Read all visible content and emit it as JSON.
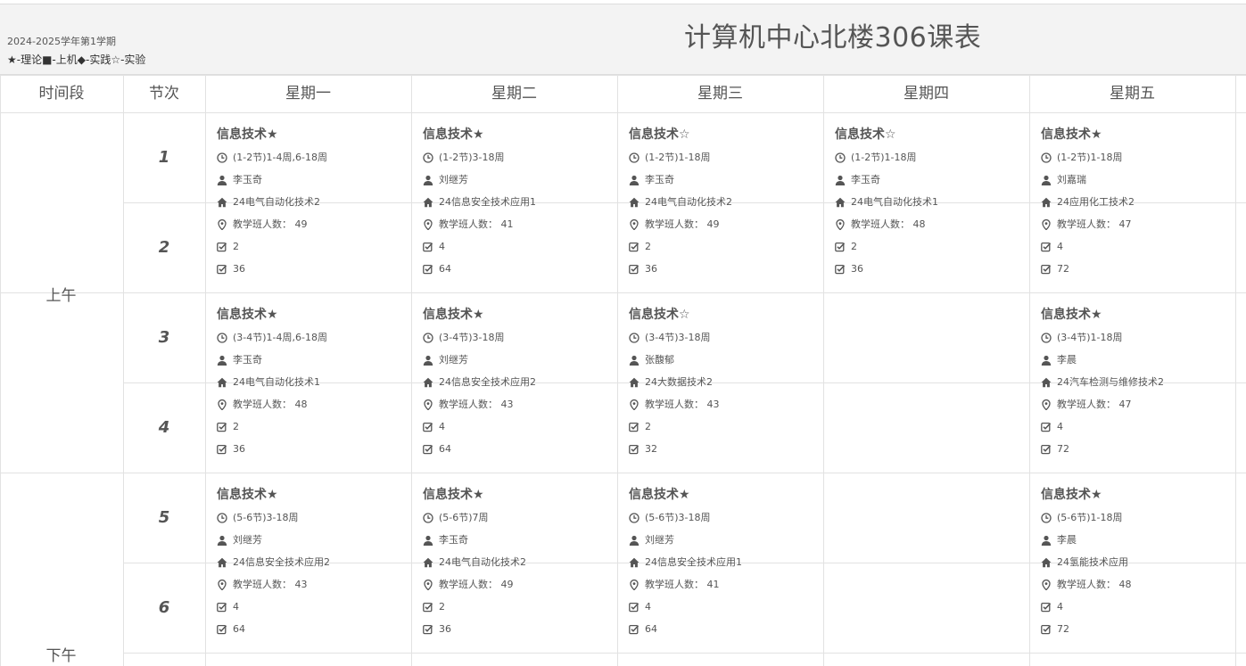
{
  "header": {
    "term": "2024-2025学年第1学期",
    "legend": "★-理论■-上机◆-实践☆-实验",
    "title": "计算机中心北楼306课表"
  },
  "columns": [
    "时间段",
    "节次",
    "星期一",
    "星期二",
    "星期三",
    "星期四",
    "星期五"
  ],
  "periods": [
    "上午",
    "下午"
  ],
  "slots": [
    "1",
    "2",
    "3",
    "4",
    "5",
    "6"
  ],
  "courses": {
    "mon_12": {
      "name": "信息技术★",
      "time": "(1-2节)1-4周,6-18周",
      "teacher": "李玉奇",
      "class": "24电气自动化技术2",
      "size": "教学班人数： 49",
      "credit": "2",
      "hours": "36"
    },
    "tue_12": {
      "name": "信息技术★",
      "time": "(1-2节)3-18周",
      "teacher": "刘继芳",
      "class": "24信息安全技术应用1",
      "size": "教学班人数： 41",
      "credit": "4",
      "hours": "64"
    },
    "wed_12": {
      "name": "信息技术☆",
      "time": "(1-2节)1-18周",
      "teacher": "李玉奇",
      "class": "24电气自动化技术2",
      "size": "教学班人数： 49",
      "credit": "2",
      "hours": "36"
    },
    "thu_12": {
      "name": "信息技术☆",
      "time": "(1-2节)1-18周",
      "teacher": "李玉奇",
      "class": "24电气自动化技术1",
      "size": "教学班人数： 48",
      "credit": "2",
      "hours": "36"
    },
    "fri_12": {
      "name": "信息技术★",
      "time": "(1-2节)1-18周",
      "teacher": "刘嘉瑞",
      "class": "24应用化工技术2",
      "size": "教学班人数： 47",
      "credit": "4",
      "hours": "72"
    },
    "mon_34": {
      "name": "信息技术★",
      "time": "(3-4节)1-4周,6-18周",
      "teacher": "李玉奇",
      "class": "24电气自动化技术1",
      "size": "教学班人数： 48",
      "credit": "2",
      "hours": "36"
    },
    "tue_34": {
      "name": "信息技术★",
      "time": "(3-4节)3-18周",
      "teacher": "刘继芳",
      "class": "24信息安全技术应用2",
      "size": "教学班人数： 43",
      "credit": "4",
      "hours": "64"
    },
    "wed_34": {
      "name": "信息技术☆",
      "time": "(3-4节)3-18周",
      "teacher": "张馥郁",
      "class": "24大数据技术2",
      "size": "教学班人数： 43",
      "credit": "2",
      "hours": "32"
    },
    "fri_34": {
      "name": "信息技术★",
      "time": "(3-4节)1-18周",
      "teacher": "李晨",
      "class": "24汽车检测与维修技术2",
      "size": "教学班人数： 47",
      "credit": "4",
      "hours": "72"
    },
    "mon_56": {
      "name": "信息技术★",
      "time": "(5-6节)3-18周",
      "teacher": "刘继芳",
      "class": "24信息安全技术应用2",
      "size": "教学班人数： 43",
      "credit": "4",
      "hours": "64"
    },
    "tue_56": {
      "name": "信息技术★",
      "time": "(5-6节)7周",
      "teacher": "李玉奇",
      "class": "24电气自动化技术2",
      "size": "教学班人数： 49",
      "credit": "2",
      "hours": "36"
    },
    "wed_56": {
      "name": "信息技术★",
      "time": "(5-6节)3-18周",
      "teacher": "刘继芳",
      "class": "24信息安全技术应用1",
      "size": "教学班人数： 41",
      "credit": "4",
      "hours": "64"
    },
    "fri_56": {
      "name": "信息技术★",
      "time": "(5-6节)1-18周",
      "teacher": "李晨",
      "class": "24氢能技术应用",
      "size": "教学班人数： 48",
      "credit": "4",
      "hours": "72"
    }
  },
  "icons": [
    "clock-icon",
    "user-icon",
    "home-icon",
    "location-icon",
    "check-square-icon"
  ]
}
